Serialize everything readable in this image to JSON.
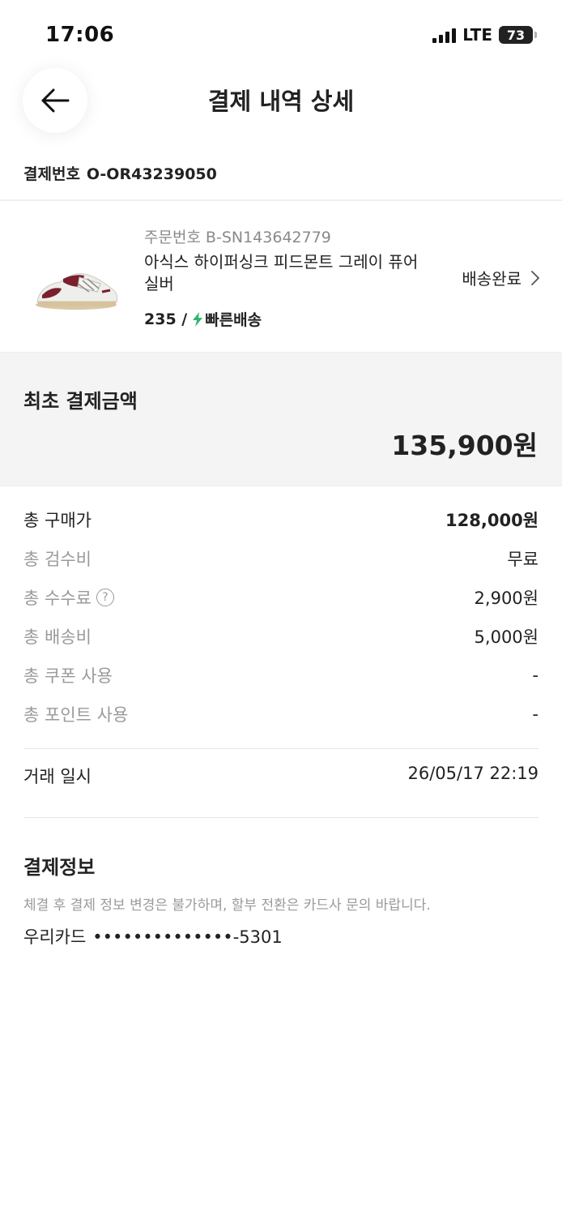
{
  "status_bar": {
    "time": "17:06",
    "network": "LTE",
    "battery": "73"
  },
  "header": {
    "title": "결제 내역 상세",
    "back_icon": "arrow-left-icon"
  },
  "payment": {
    "number_label": "결제번호",
    "number": "O-OR43239050"
  },
  "order": {
    "order_no_label": "주문번호",
    "order_no": "B-SN143642779",
    "product_name": "아식스 하이퍼싱크 피드몬트 그레이 퓨어 실버",
    "size": "235 /",
    "shipping_type": "빠른배송",
    "delivery_status": "배송완료",
    "colors": {
      "bolt": "#31b46e"
    }
  },
  "total": {
    "label": "최초 결제금액",
    "amount": "135,900원"
  },
  "fees": [
    {
      "label": "총 구매가",
      "value": "128,000원"
    },
    {
      "label": "총 검수비",
      "value": "무료"
    },
    {
      "label": "총 수수료",
      "value": "2,900원",
      "help": "?"
    },
    {
      "label": "총 배송비",
      "value": "5,000원"
    },
    {
      "label": "총 쿠폰 사용",
      "value": "-"
    },
    {
      "label": "총 포인트 사용",
      "value": "-"
    }
  ],
  "transaction": {
    "label": "거래 일시",
    "value": "26/05/17 22:19"
  },
  "payment_info": {
    "title": "결제정보",
    "note": "체결 후 결제 정보 변경은 불가하며, 할부 전환은 카드사 문의 바랍니다.",
    "card_name": "우리카드",
    "card_number": "••••••••••••••-5301"
  }
}
